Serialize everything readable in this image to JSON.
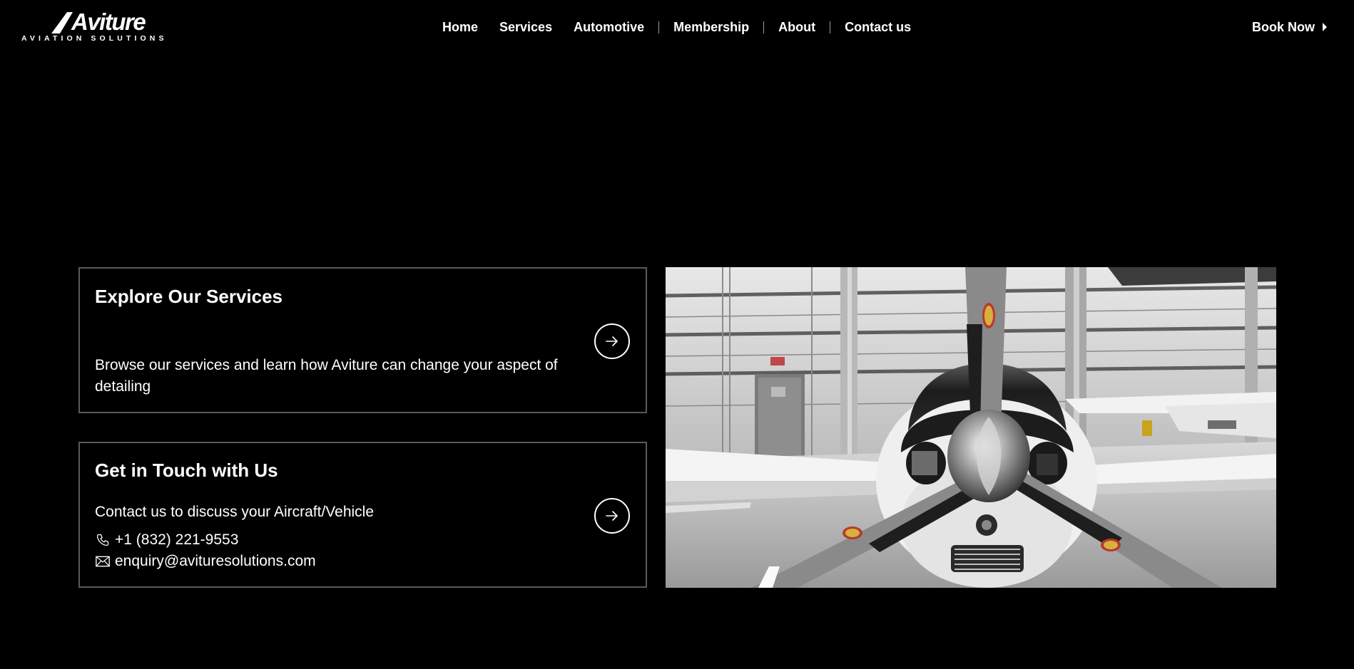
{
  "brand": {
    "name": "Aviture",
    "tagline": "AVIATION SOLUTIONS"
  },
  "nav": {
    "items": [
      "Home",
      "Services",
      "Automotive",
      "Membership",
      "About",
      "Contact us"
    ]
  },
  "header": {
    "cta_label": "Book Now"
  },
  "cards": {
    "services": {
      "title": "Explore Our Services",
      "description": "Browse our services and learn how Aviture can change your aspect of detailing"
    },
    "contact": {
      "title": "Get in Touch with Us",
      "description": "Contact us to discuss your Aircraft/Vehicle",
      "phone": "+1 (832) 221-9553",
      "email": "enquiry@avituresolutions.com"
    }
  },
  "icons": {
    "arrow": "arrow-right-icon",
    "phone": "phone-icon",
    "email": "mail-icon",
    "caret": "caret-right-icon"
  },
  "colors": {
    "background": "#000000",
    "text": "#ffffff",
    "card_border": "#5a5a5a"
  }
}
